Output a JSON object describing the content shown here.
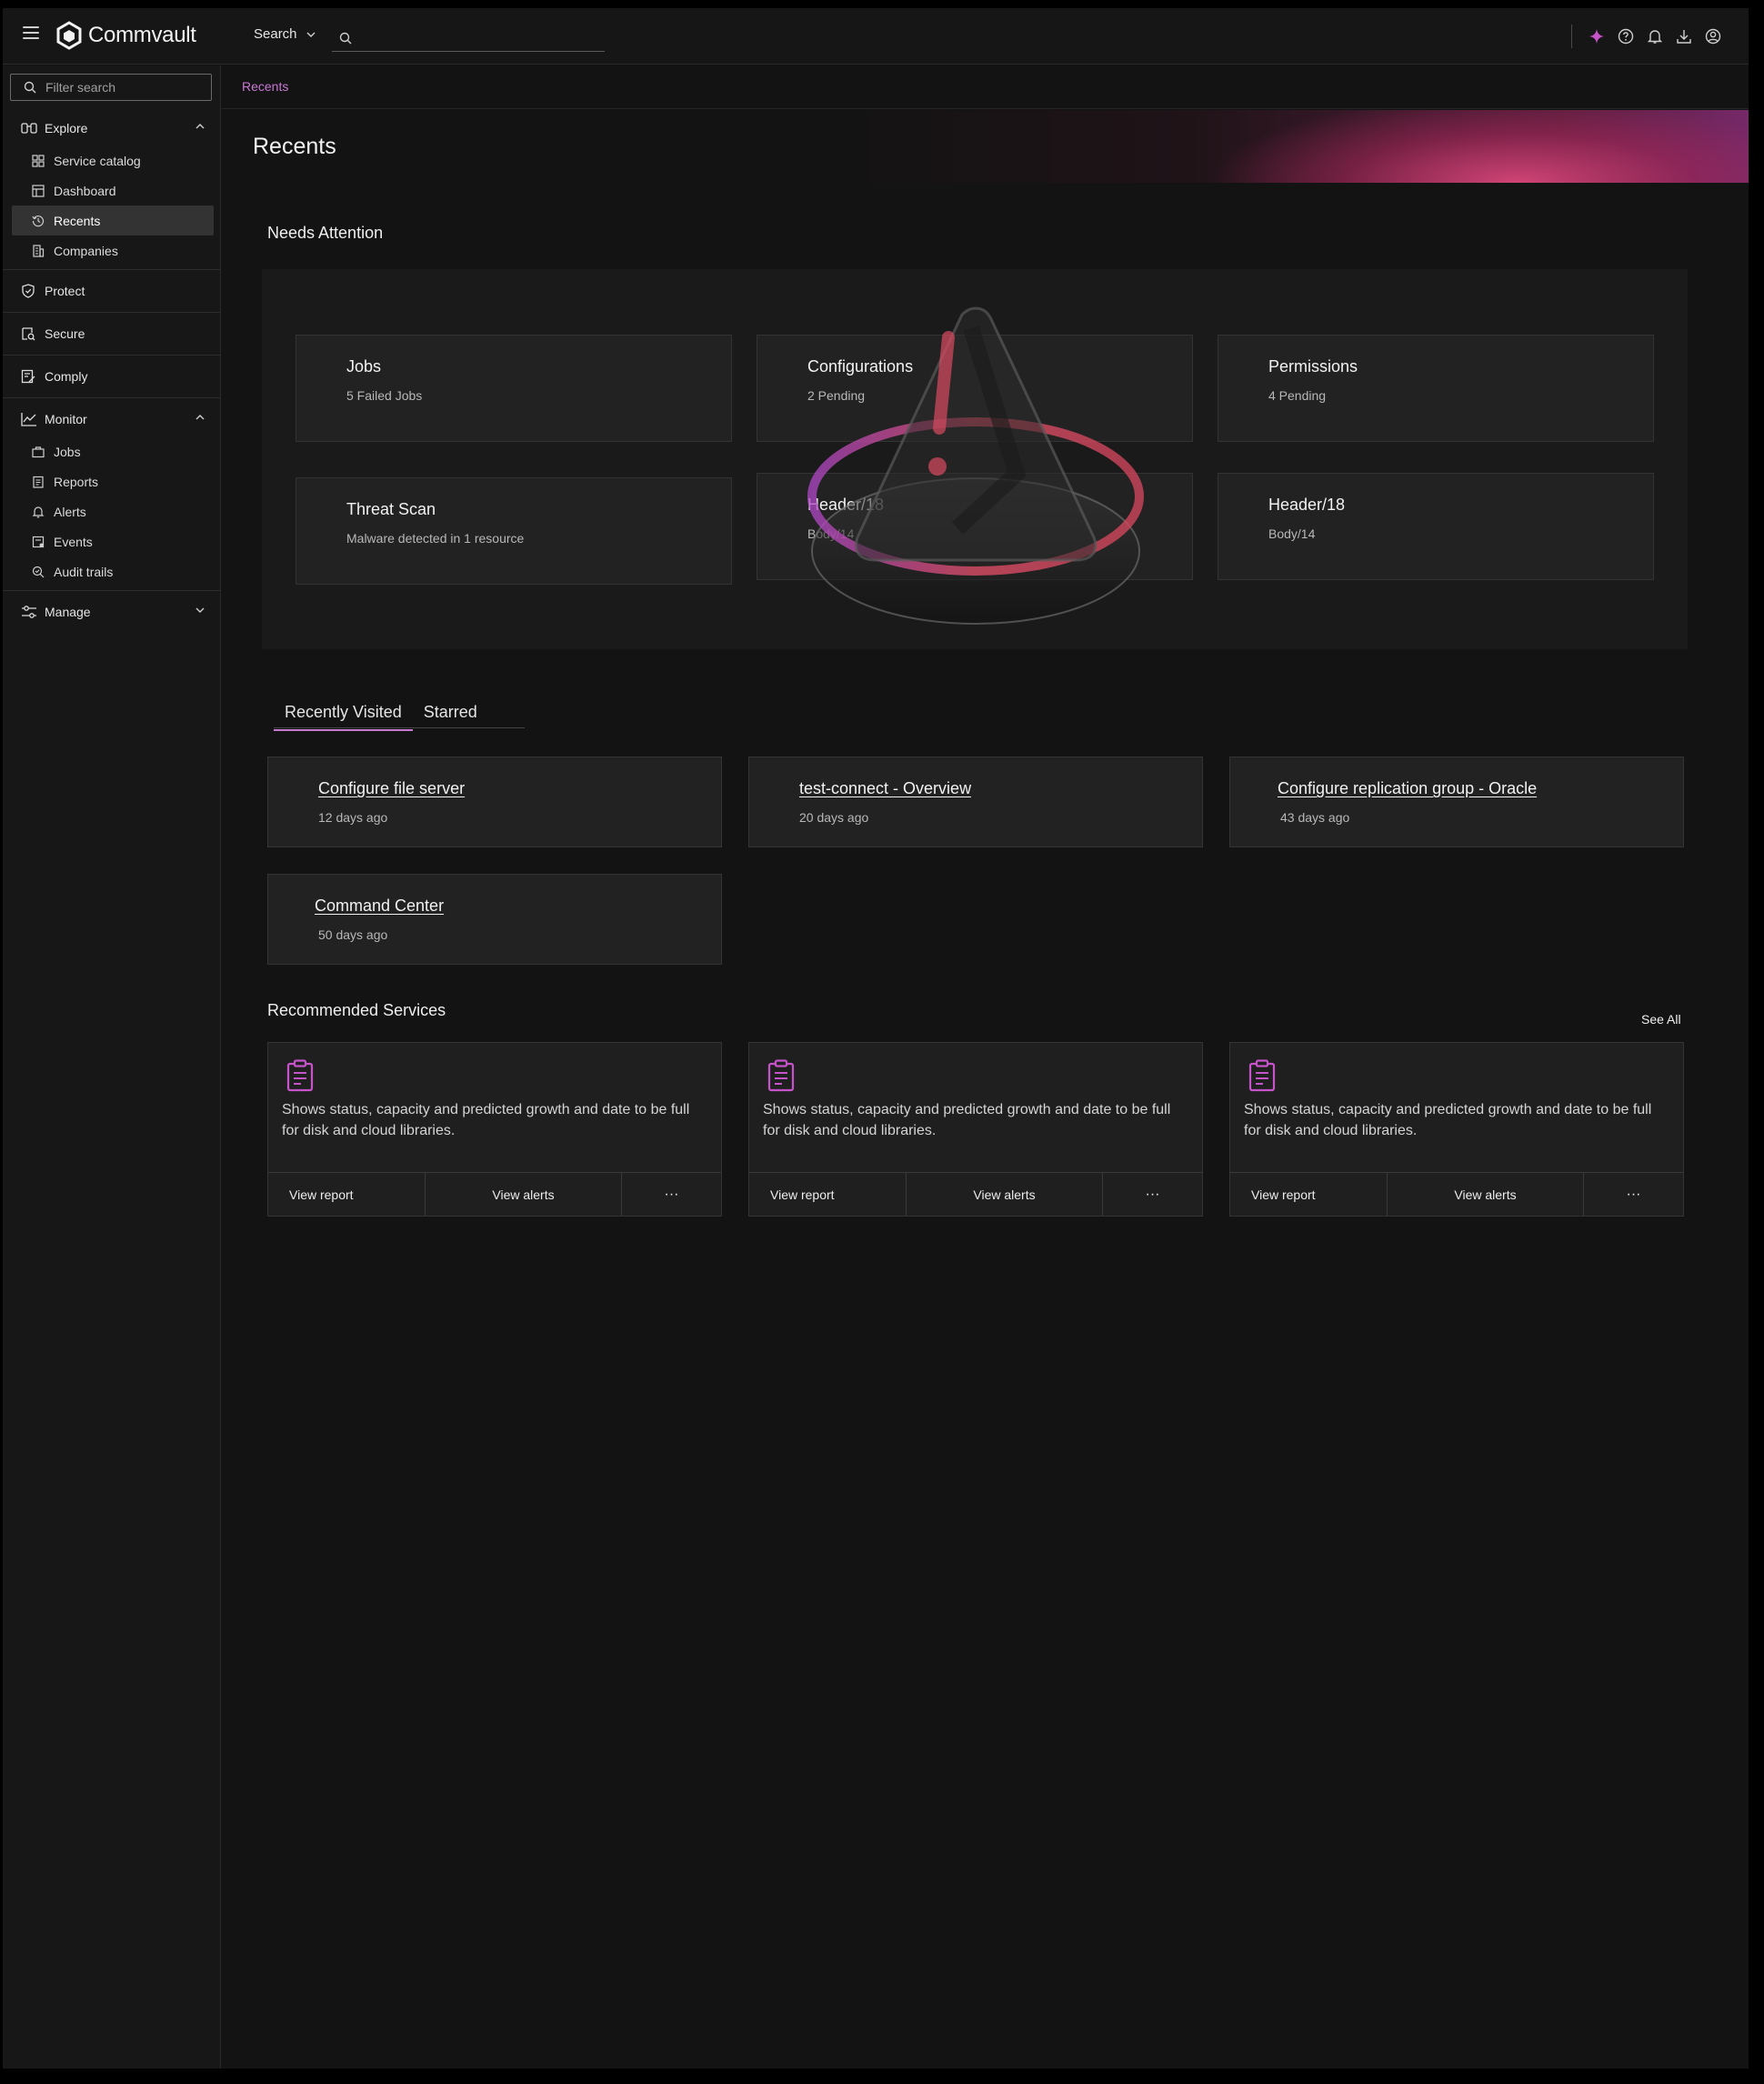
{
  "app": {
    "name": "Commvault"
  },
  "topbar": {
    "search_label": "Search",
    "search_placeholder": "",
    "icons": [
      "sparkle-icon",
      "help-icon",
      "bell-icon",
      "download-icon",
      "user-icon"
    ],
    "accent": "#c653c9"
  },
  "sidebar": {
    "filter_placeholder": "Filter search",
    "explore": {
      "label": "Explore",
      "items": [
        {
          "label": "Service catalog",
          "icon": "grid-icon"
        },
        {
          "label": "Dashboard",
          "icon": "dashboard-icon"
        },
        {
          "label": "Recents",
          "icon": "history-icon",
          "active": true
        },
        {
          "label": "Companies",
          "icon": "building-icon"
        }
      ]
    },
    "protect": {
      "label": "Protect"
    },
    "secure": {
      "label": "Secure"
    },
    "comply": {
      "label": "Comply"
    },
    "monitor": {
      "label": "Monitor",
      "items": [
        {
          "label": "Jobs",
          "icon": "briefcase-icon"
        },
        {
          "label": "Reports",
          "icon": "report-icon"
        },
        {
          "label": "Alerts",
          "icon": "alert-bell-icon"
        },
        {
          "label": "Events",
          "icon": "events-icon"
        },
        {
          "label": "Audit trails",
          "icon": "audit-icon"
        }
      ]
    },
    "manage": {
      "label": "Manage"
    }
  },
  "breadcrumb": {
    "current": "Recents"
  },
  "page": {
    "title": "Recents"
  },
  "needs_attention": {
    "title": "Needs Attention",
    "cards": [
      {
        "title": "Jobs",
        "subtitle": "5 Failed Jobs"
      },
      {
        "title": "Configurations",
        "subtitle": "2 Pending"
      },
      {
        "title": "Permissions",
        "subtitle": "4 Pending"
      },
      {
        "title": "Threat Scan",
        "subtitle": "Malware detected in 1 resource"
      },
      {
        "title": "Header/18",
        "subtitle": "Body/14"
      },
      {
        "title": "Header/18",
        "subtitle": "Body/14"
      }
    ]
  },
  "tabs": [
    {
      "label": "Recently Visited",
      "active": true
    },
    {
      "label": "Starred",
      "active": false
    }
  ],
  "recent": [
    {
      "title": "Configure file server",
      "time": "12 days ago"
    },
    {
      "title": "test-connect - Overview",
      "time": "20 days ago"
    },
    {
      "title": "Configure replication group - Oracle",
      "time": "43 days ago"
    },
    {
      "title": "Command Center",
      "time": "50 days ago"
    }
  ],
  "recommended": {
    "title": "Recommended Services",
    "see_all": "See All",
    "services": [
      {
        "description": "Shows status, capacity and predicted growth and date to be full for disk and cloud libraries.",
        "action1": "View report",
        "action2": "View alerts",
        "more": "···"
      },
      {
        "description": "Shows status, capacity and predicted growth and date to be full for disk and cloud libraries.",
        "action1": "View report",
        "action2": "View alerts",
        "more": "···"
      },
      {
        "description": "Shows status, capacity and predicted growth and date to be full for disk and cloud libraries.",
        "action1": "View report",
        "action2": "View alerts",
        "more": "···"
      }
    ]
  }
}
